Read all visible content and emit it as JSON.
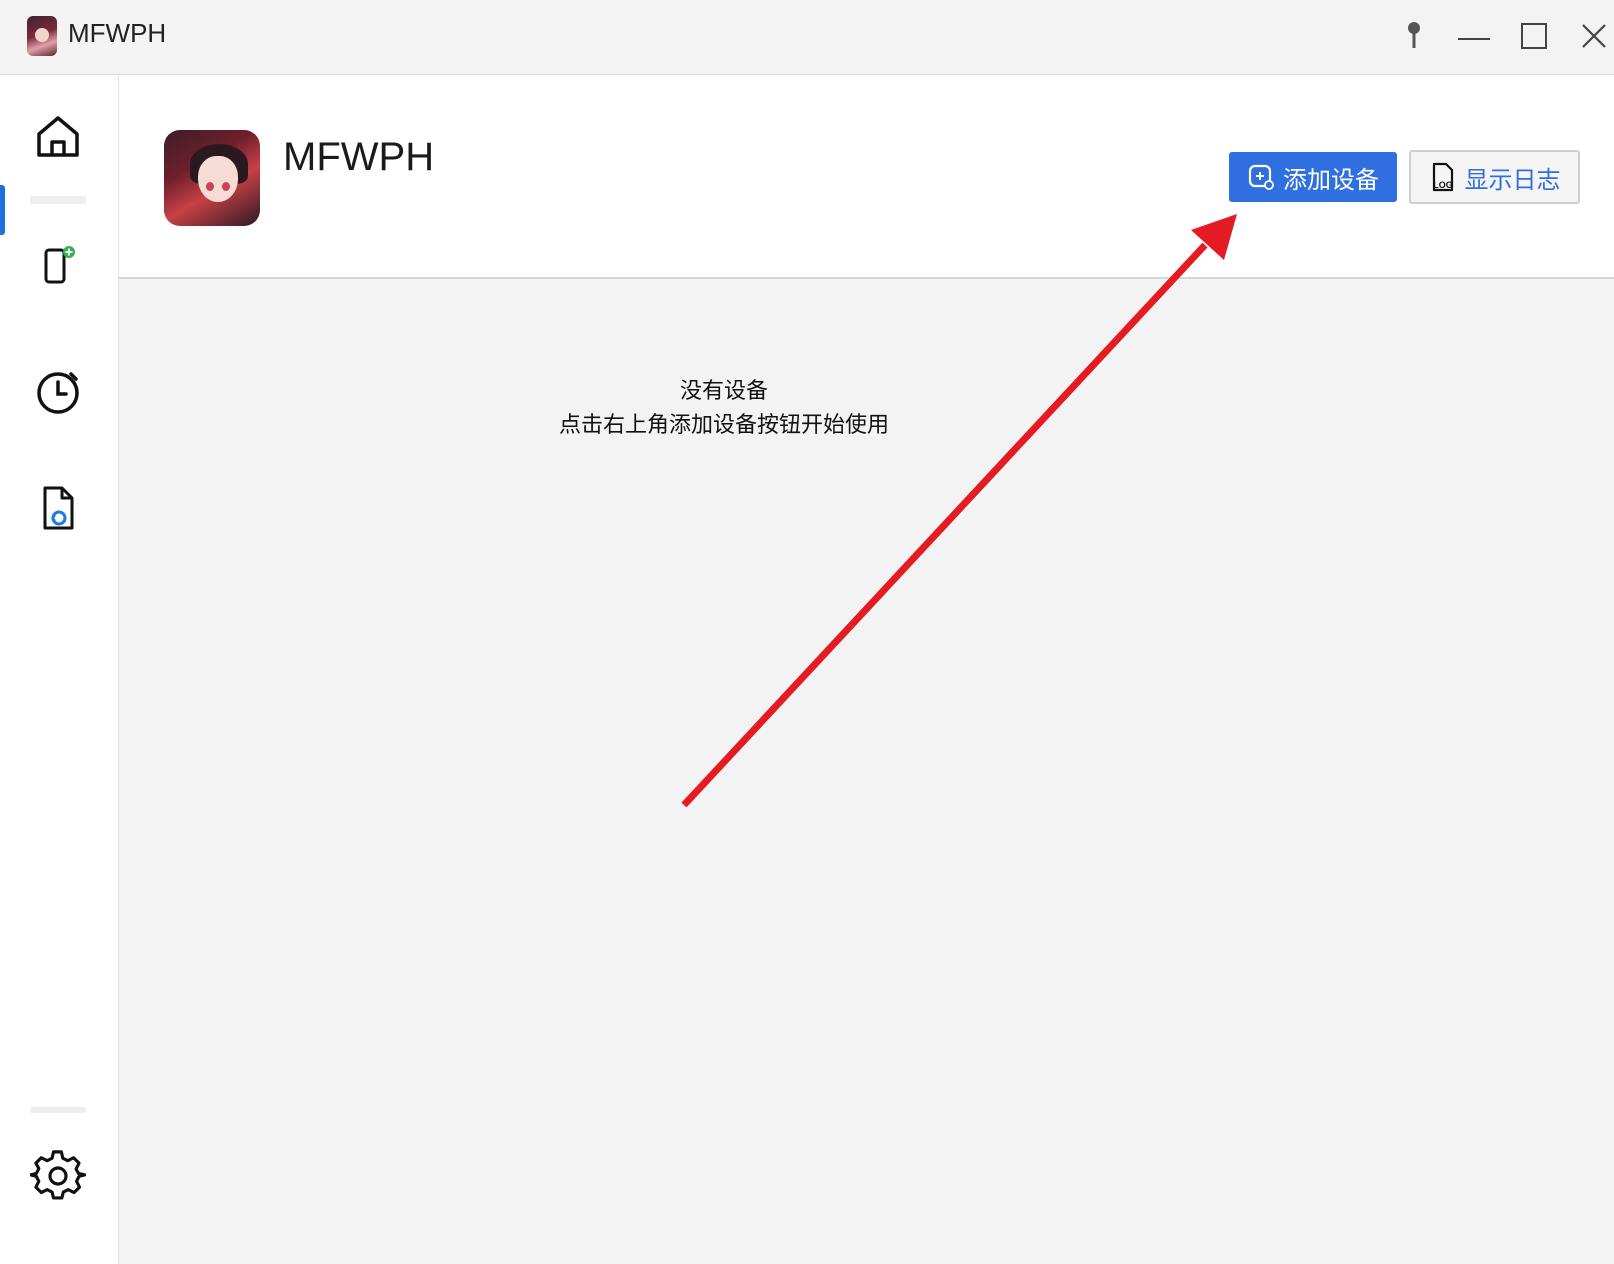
{
  "window": {
    "title": "MFWPH",
    "controls": [
      "pin-icon",
      "minimize-icon",
      "maximize-icon",
      "close-icon"
    ]
  },
  "sidebar": {
    "items": [
      {
        "name": "home",
        "icon": "home-icon",
        "active": true
      },
      {
        "name": "add-device",
        "icon": "phone-add-icon",
        "active": false
      },
      {
        "name": "schedule",
        "icon": "clock-icon",
        "active": false
      },
      {
        "name": "update",
        "icon": "file-sync-icon",
        "active": false
      }
    ],
    "footer": {
      "name": "settings",
      "icon": "gear-icon"
    }
  },
  "header": {
    "title": "MFWPH",
    "add_device_label": "添加设备",
    "show_log_label": "显示日志",
    "log_icon_text": "LOG"
  },
  "empty_state": {
    "line1": "没有设备",
    "line2": "点击右上角添加设备按钮开始使用"
  },
  "colors": {
    "accent": "#2f6fe0",
    "annotation_arrow": "#e41b23",
    "active_indicator": "#1e6fd9"
  }
}
